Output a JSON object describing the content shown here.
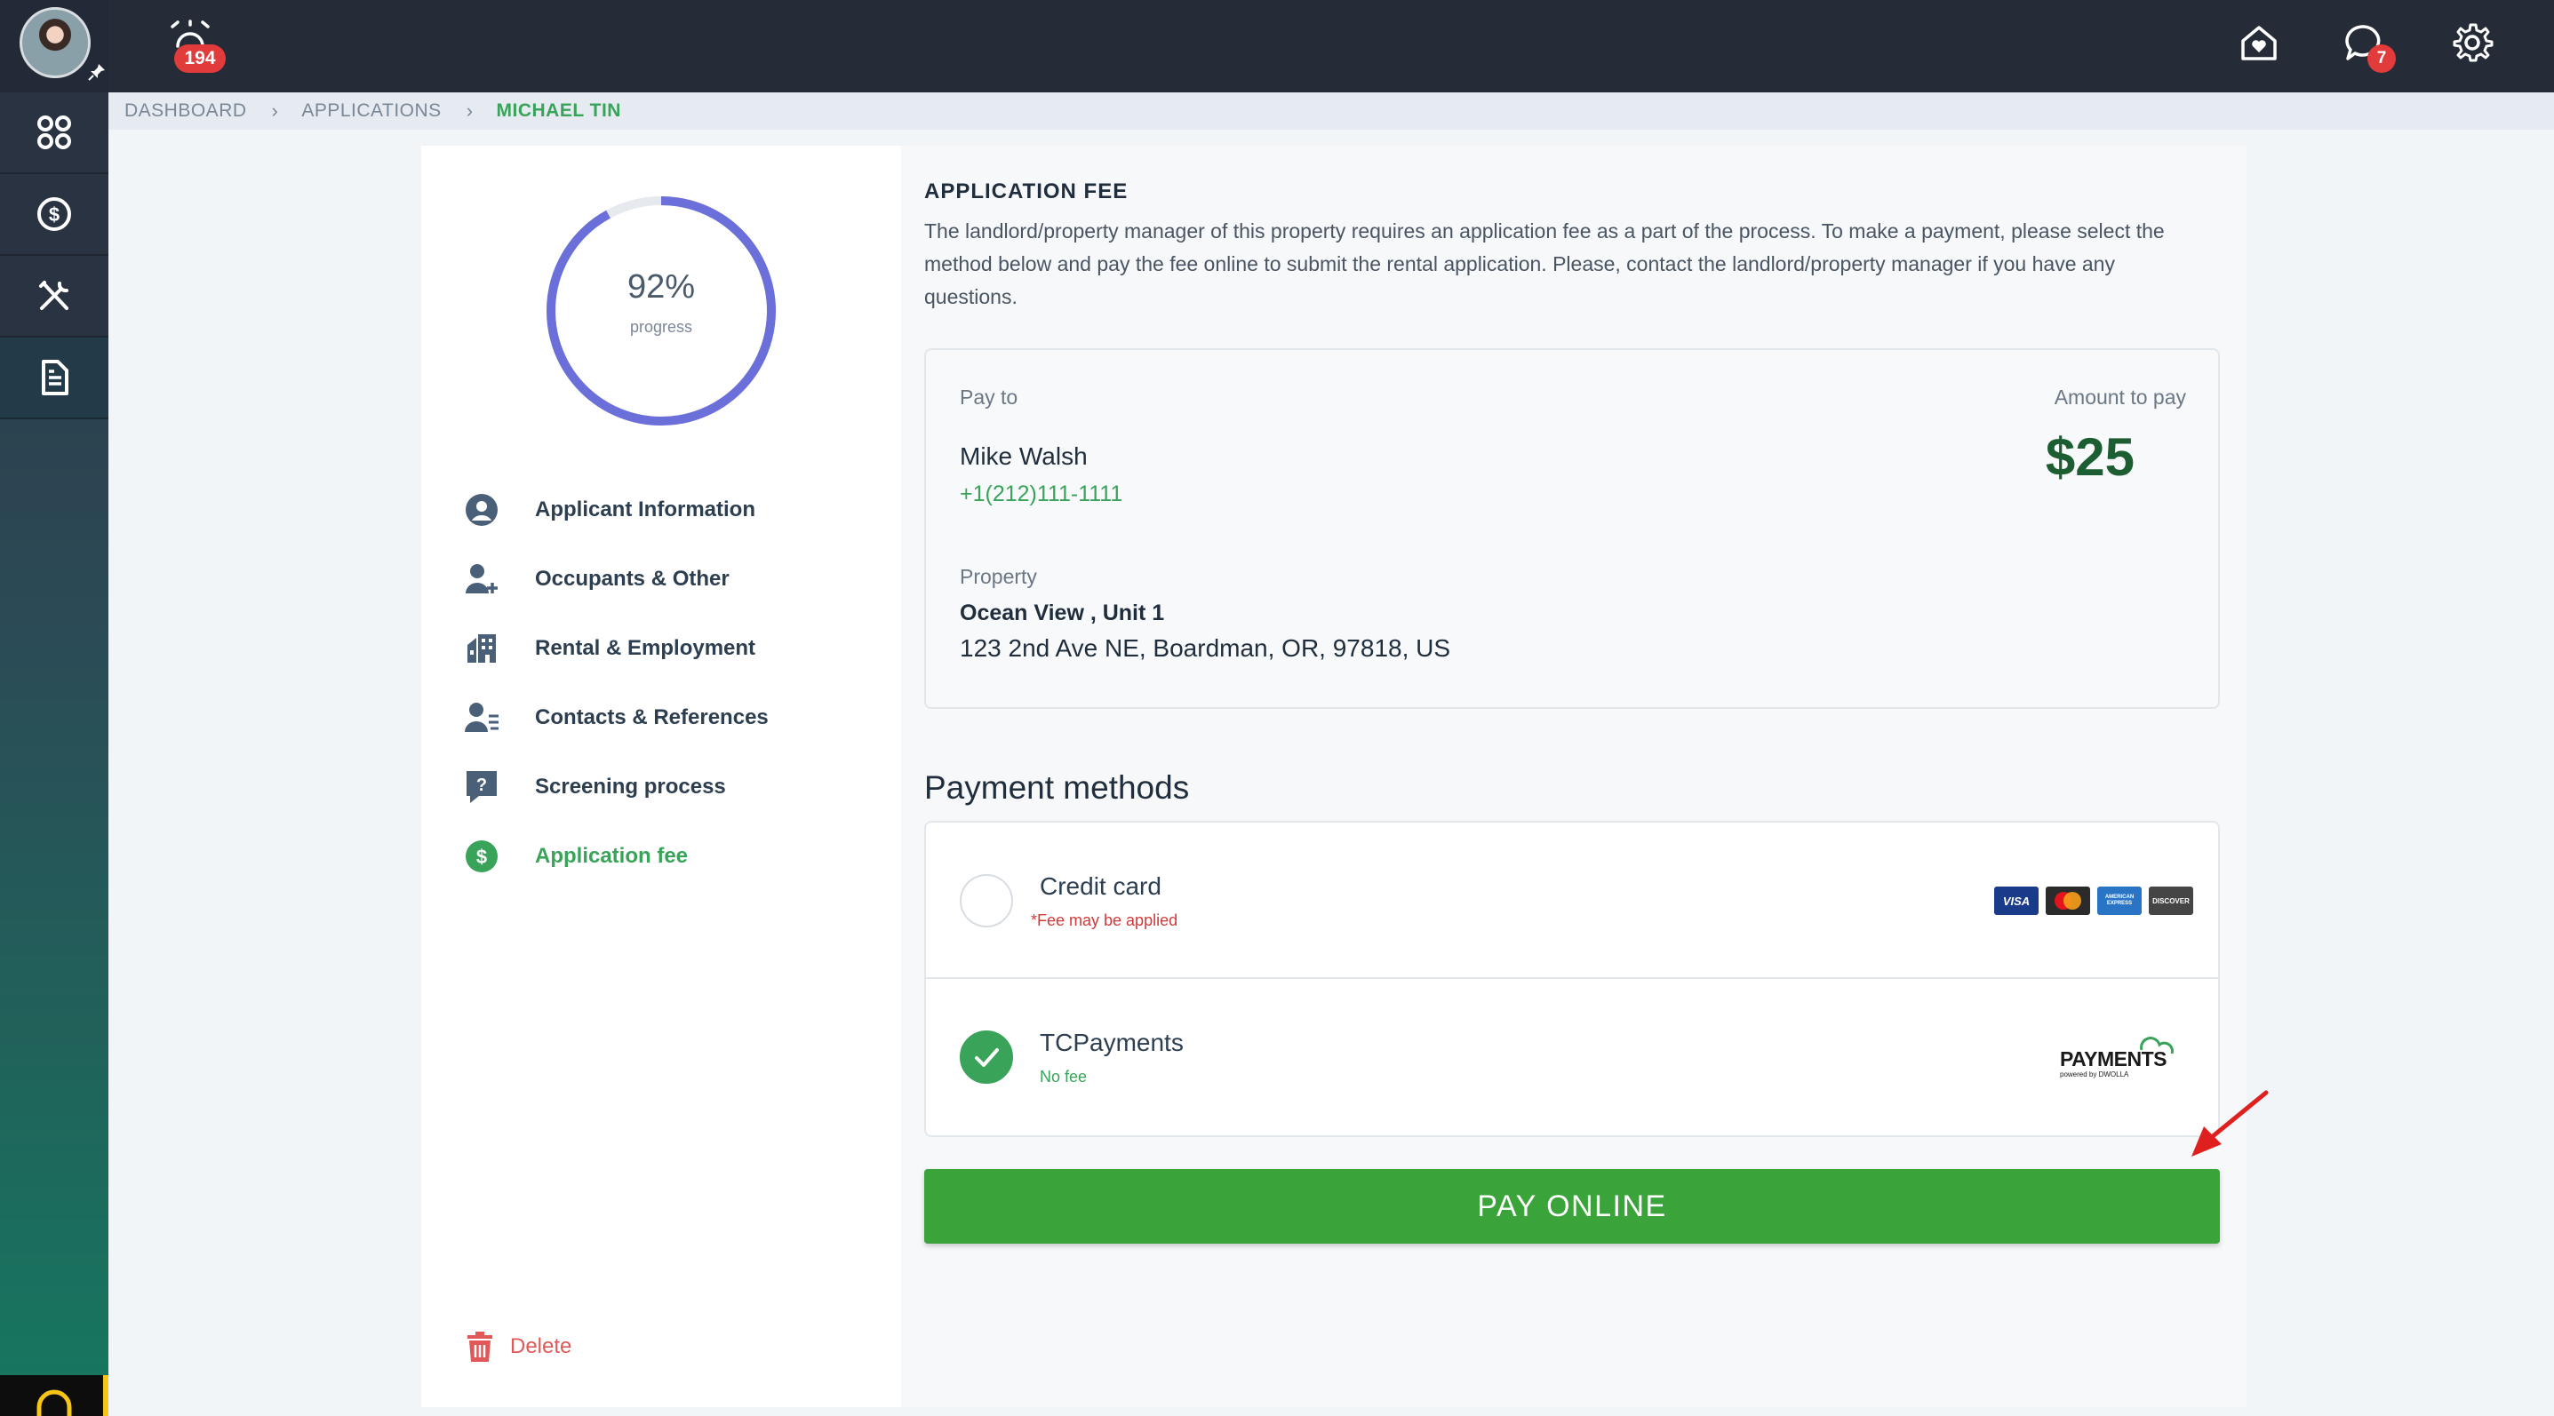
{
  "topbar": {
    "alarm_count": "194",
    "messages_count": "7"
  },
  "breadcrumb": {
    "items": [
      "DASHBOARD",
      "APPLICATIONS",
      "MICHAEL TIN"
    ]
  },
  "progress": {
    "percent_label": "92%",
    "percent_value": 92,
    "caption": "progress",
    "color": "#6b6fd9"
  },
  "steps": [
    {
      "label": "Applicant Information",
      "icon": "user-circle-icon"
    },
    {
      "label": "Occupants & Other",
      "icon": "user-plus-icon"
    },
    {
      "label": "Rental & Employment",
      "icon": "building-icon"
    },
    {
      "label": "Contacts & References",
      "icon": "contact-list-icon"
    },
    {
      "label": "Screening process",
      "icon": "question-chat-icon"
    },
    {
      "label": "Application fee",
      "icon": "dollar-circle-icon"
    }
  ],
  "delete_label": "Delete",
  "fee": {
    "title": "APPLICATION FEE",
    "description": "The landlord/property manager of this property requires an application fee as a part of the process. To make a payment, please select the method below and pay the fee online to submit the rental application. Please, contact the landlord/property manager if you have any questions.",
    "pay_to_label": "Pay to",
    "pay_to_name": "Mike Walsh",
    "pay_to_phone": "+1(212)111-1111",
    "amount_label": "Amount to pay",
    "amount": "$25",
    "property_label": "Property",
    "property_name": "Ocean View , Unit 1",
    "property_address": "123 2nd Ave NE, Boardman, OR, 97818, US"
  },
  "payment_methods": {
    "title": "Payment methods",
    "credit_card": {
      "name": "Credit card",
      "note": "*Fee may be applied",
      "brands": [
        "VISA",
        "MasterCard",
        "AMERICAN EXPRESS",
        "DISCOVER"
      ]
    },
    "tcpayments": {
      "name": "TCPayments",
      "note": "No fee",
      "logo_text": "PAYMENTS",
      "logo_sub": "powered by DWOLLA",
      "selected": true
    }
  },
  "pay_button_label": "PAY ONLINE",
  "colors": {
    "accent_green": "#3aa339",
    "badge_red": "#e23b3b",
    "annotation_red": "#e0201f"
  }
}
